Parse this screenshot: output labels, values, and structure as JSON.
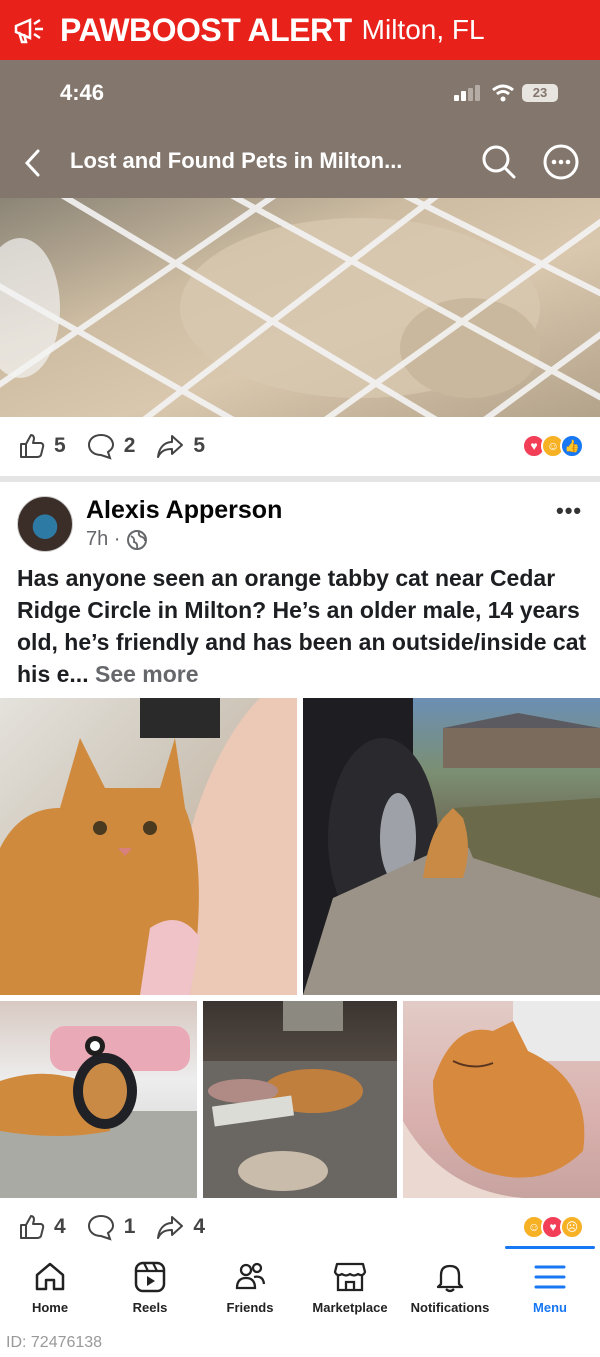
{
  "alert": {
    "brand": "PAWBOOST ALERT",
    "location": "Milton, FL"
  },
  "status": {
    "time": "4:46",
    "battery": "23"
  },
  "header": {
    "title": "Lost and Found Pets in Milton..."
  },
  "first_post": {
    "likes": "5",
    "comments": "2",
    "shares": "5"
  },
  "post": {
    "author": "Alexis Apperson",
    "time": "7h ·",
    "text": "Has anyone seen an orange tabby cat near Cedar Ridge Circle in Milton? He’s an older male, 14 years old, he’s friendly and has been an outside/inside cat his e...",
    "see_more": "See more",
    "likes": "4",
    "comments": "1",
    "shares": "4"
  },
  "nav": [
    {
      "label": "Home",
      "icon": "home-icon"
    },
    {
      "label": "Reels",
      "icon": "reels-icon"
    },
    {
      "label": "Friends",
      "icon": "friends-icon"
    },
    {
      "label": "Marketplace",
      "icon": "marketplace-icon"
    },
    {
      "label": "Notifications",
      "icon": "bell-icon"
    },
    {
      "label": "Menu",
      "icon": "menu-icon"
    }
  ],
  "footer_id": "ID: 72476138",
  "colors": {
    "alert_red": "#e8221b",
    "header_bg": "#83766d",
    "accent": "#1877f2"
  }
}
